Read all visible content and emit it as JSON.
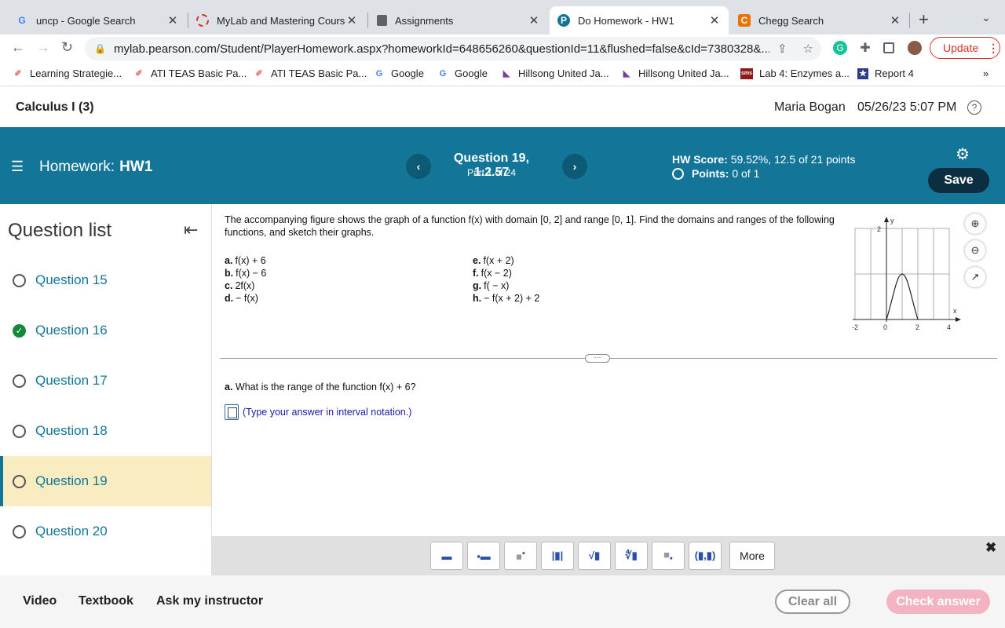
{
  "browser": {
    "tabs": [
      {
        "title": "uncp - Google Search",
        "icon": "google-icon"
      },
      {
        "title": "MyLab and Mastering Course",
        "icon": "pearson-ring-icon"
      },
      {
        "title": "Assignments",
        "icon": "document-icon"
      },
      {
        "title": "Do Homework - HW1",
        "icon": "pearson-icon"
      },
      {
        "title": "Chegg Search",
        "icon": "chegg-icon"
      }
    ],
    "url": "mylab.pearson.com/Student/PlayerHomework.aspx?homeworkId=648656260&questionId=11&flushed=false&cId=7380328&...",
    "update_label": "Update",
    "bookmarks": [
      "Learning Strategie...",
      "ATI TEAS Basic Pa...",
      "ATI TEAS Basic Pa...",
      "Google",
      "Google",
      "Hillsong United Ja...",
      "Hillsong United Ja...",
      "Lab 4: Enzymes a...",
      "Report 4"
    ]
  },
  "header": {
    "course": "Calculus I (3)",
    "user": "Maria Bogan",
    "datetime": "05/26/23 5:07 PM"
  },
  "hwbar": {
    "hw_prefix": "Homework:",
    "hw_name": "HW1",
    "question_title": "Question 19, 1.2.57",
    "question_part": "Part 1 of 24",
    "score_label": "HW Score:",
    "score_value": "59.52%, 12.5 of 21 points",
    "points_label": "Points:",
    "points_value": "0 of 1",
    "save_label": "Save"
  },
  "sidebar": {
    "title": "Question list",
    "items": [
      {
        "label": "Question 15",
        "status": "open"
      },
      {
        "label": "Question 16",
        "status": "done"
      },
      {
        "label": "Question 17",
        "status": "open"
      },
      {
        "label": "Question 18",
        "status": "open"
      },
      {
        "label": "Question 19",
        "status": "current"
      },
      {
        "label": "Question 20",
        "status": "open"
      }
    ]
  },
  "problem": {
    "text": "The accompanying figure shows the graph of a function f(x) with domain [0, 2] and range [0, 1]. Find the domains and ranges of the following functions, and sketch their graphs.",
    "parts_left": [
      {
        "key": "a.",
        "expr": "f(x) + 6"
      },
      {
        "key": "b.",
        "expr": "f(x) − 6"
      },
      {
        "key": "c.",
        "expr": "2f(x)"
      },
      {
        "key": "d.",
        "expr": "− f(x)"
      }
    ],
    "parts_right": [
      {
        "key": "e.",
        "expr": "f(x + 2)"
      },
      {
        "key": "f.",
        "expr": "f(x − 2)"
      },
      {
        "key": "g.",
        "expr": "f( − x)"
      },
      {
        "key": "h.",
        "expr": "− f(x + 2) + 2"
      }
    ],
    "graph": {
      "y_axis_label": "y",
      "x_axis_label": "x",
      "y_tick": "2",
      "x_ticks": [
        "-2",
        "0",
        "2",
        "4"
      ]
    }
  },
  "answer": {
    "question": "What is the range of the function f(x) + 6?",
    "question_key": "a.",
    "hint": "(Type your answer in interval notation.)"
  },
  "mathbar": {
    "more_label": "More",
    "buttons": [
      "fraction",
      "mixed-number",
      "exponent",
      "absolute-value",
      "square-root",
      "nth-root",
      "subscript",
      "interval"
    ]
  },
  "footer": {
    "video": "Video",
    "textbook": "Textbook",
    "ask": "Ask my instructor",
    "clear": "Clear all",
    "check": "Check answer"
  }
}
